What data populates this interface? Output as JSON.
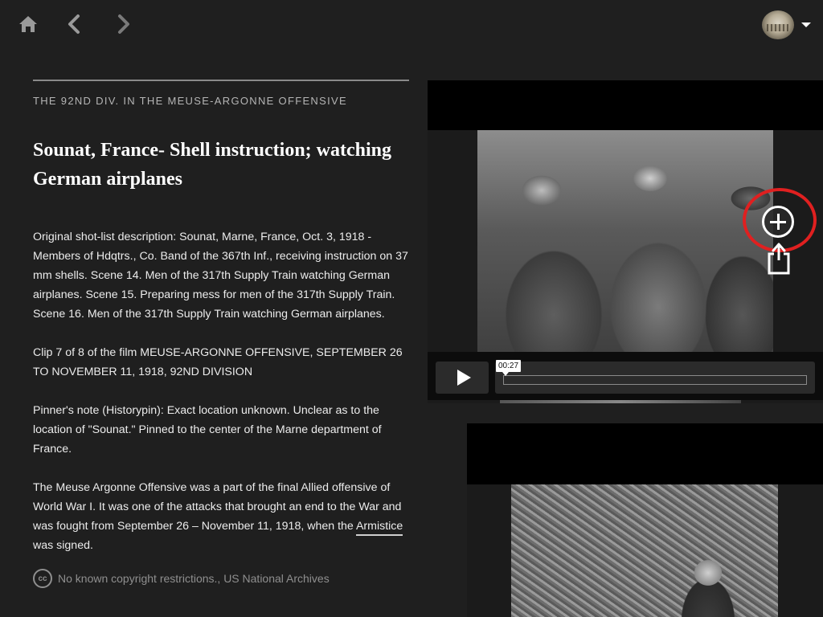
{
  "nav": {
    "home_icon": "home-icon",
    "back_icon": "chevron-left-icon",
    "forward_icon": "chevron-right-icon"
  },
  "user_menu": {
    "avatar_icon": "avatar",
    "caret_icon": "caret-down-icon"
  },
  "content": {
    "collection": "THE 92ND DIV. IN THE MEUSE-ARGONNE OFFENSIVE",
    "title": "Sounat, France- Shell instruction; watching German airplanes",
    "paragraphs": [
      "Original shot-list description: Sounat, Marne, France, Oct. 3, 1918 - Members of Hdqtrs., Co. Band of the 367th Inf., receiving instruction on 37 mm shells. Scene 14. Men of the 317th Supply Train watching German airplanes. Scene 15. Preparing mess for men of the 317th Supply Train. Scene 16. Men of the 317th Supply Train watching German airplanes.",
      "Clip 7 of 8 of the film MEUSE-ARGONNE OFFENSIVE, SEPTEMBER 26 TO NOVEMBER 11, 1918, 92ND DIVISION",
      "Pinner's note (Historypin): Exact location unknown. Unclear as to the location of \"Sounat.\" Pinned to the center of the Marne department of France."
    ],
    "last_paragraph_before": "The Meuse Argonne Offensive was a part of the final Allied offensive of World War I. It was one of the attacks that brought an end to the War and was fought from September 26 – November 11, 1918, when the ",
    "last_paragraph_link": "Armistice",
    "last_paragraph_after": " was signed.",
    "rights_icon": "cc-icon",
    "rights_icon_text": "cc",
    "rights": "No known copyright restrictions., US National Archives"
  },
  "player": {
    "time": "00:27",
    "play_icon": "play-icon",
    "progress": 0.0
  },
  "actions": {
    "add_icon": "plus-circle-icon",
    "share_icon": "share-icon",
    "highlight_color": "#e02020"
  },
  "colors": {
    "background": "#1f1f1f",
    "text": "#ececec",
    "muted": "#8f8f8f"
  }
}
